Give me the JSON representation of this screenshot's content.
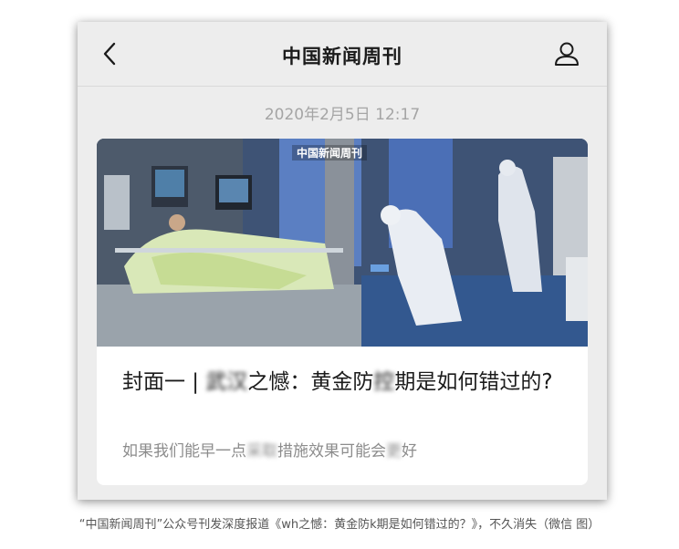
{
  "header": {
    "back_icon": "chevron-left-icon",
    "title": "中国新闻周刊",
    "profile_icon": "person-outline-icon"
  },
  "timestamp": "2020年2月5日 12:17",
  "card": {
    "image_watermark": "中国新闻周刊",
    "title_prefix": "封面一 | ",
    "title_blur1": "武汉",
    "title_mid": "之憾：黄金防",
    "title_blur2": "控",
    "title_suffix": "期是如何错过的?",
    "desc_prefix": "如果我们能早一点",
    "desc_blur1": "采取",
    "desc_mid": "措施效果可能会",
    "desc_blur2": "更",
    "desc_suffix": "好"
  },
  "caption": "“中国新闻周刊”公众号刊发深度报道《wh之憾：黄金防k期是如何错过的？》，不久消失（微信 图）",
  "colors": {
    "background": "#ededed",
    "card": "#ffffff",
    "timestamp": "#a5a5a5",
    "desc": "#8c8c8c"
  }
}
